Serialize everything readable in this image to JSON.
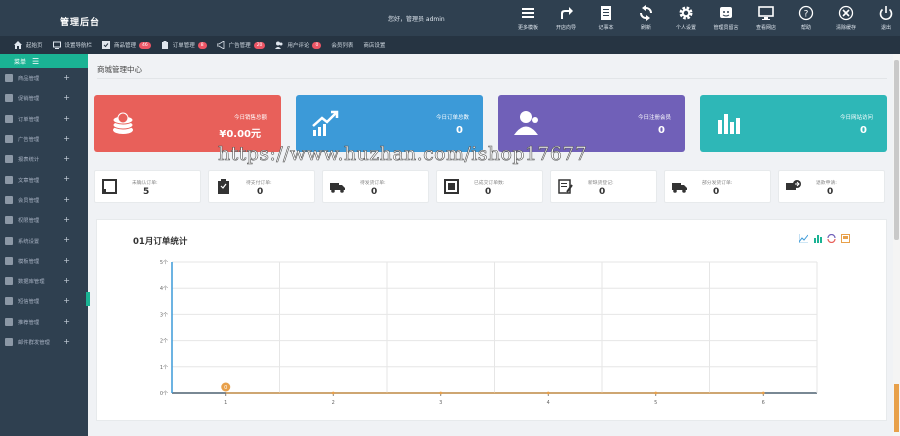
{
  "header": {
    "brand": "管理后台",
    "greeting": "您好，管理员 admin",
    "tools": [
      {
        "label": "更多模板",
        "icon": "menu-icon"
      },
      {
        "label": "开店向导",
        "icon": "share-arrow-icon"
      },
      {
        "label": "记事本",
        "icon": "notepad-icon"
      },
      {
        "label": "刷新",
        "icon": "refresh-icon"
      },
      {
        "label": "个人设置",
        "icon": "gear-icon"
      },
      {
        "label": "管理员留言",
        "icon": "message-icon"
      },
      {
        "label": "查看网店",
        "icon": "monitor-icon"
      },
      {
        "label": "帮助",
        "icon": "help-icon"
      },
      {
        "label": "清除缓存",
        "icon": "clear-cache-icon"
      },
      {
        "label": "退出",
        "icon": "power-icon"
      }
    ]
  },
  "nav": [
    {
      "label": "起始页",
      "badge": ""
    },
    {
      "label": "设置导航栏",
      "badge": ""
    },
    {
      "label": "商品管理",
      "badge": "46"
    },
    {
      "label": "订单管理",
      "badge": "8"
    },
    {
      "label": "广告管理",
      "badge": "20"
    },
    {
      "label": "用户评论",
      "badge": "0"
    },
    {
      "label": "会员列表",
      "badge": ""
    },
    {
      "label": "商店设置",
      "badge": ""
    }
  ],
  "sidebar": {
    "title": "菜单",
    "items": [
      "商品管理",
      "促销管理",
      "订单管理",
      "广告管理",
      "报表统计",
      "文章管理",
      "会员管理",
      "权限管理",
      "系统设置",
      "模板管理",
      "数据库管理",
      "短信管理",
      "推荐管理",
      "邮件群发管理"
    ]
  },
  "page_title": "商城管理中心",
  "stats": [
    {
      "label": "今日销售总额",
      "value": "¥0.00元",
      "color": "#e8605a",
      "icon": "money-coins-icon"
    },
    {
      "label": "今日订单总数",
      "value": "0",
      "color": "#3c9ad8",
      "icon": "trend-up-icon"
    },
    {
      "label": "今日注册会员",
      "value": "0",
      "color": "#7060b8",
      "icon": "users-icon"
    },
    {
      "label": "今日网站访问",
      "value": "0",
      "color": "#2eb7b7",
      "icon": "bar-chart-icon"
    }
  ],
  "cards": [
    {
      "label": "未确认订单:",
      "value": "5",
      "icon": "order-box-icon"
    },
    {
      "label": "待支付订单:",
      "value": "0",
      "icon": "payment-clipboard-icon"
    },
    {
      "label": "待发货订单:",
      "value": "0",
      "icon": "truck-icon"
    },
    {
      "label": "已成交订单数:",
      "value": "0",
      "icon": "deal-icon"
    },
    {
      "label": "新缺货登记:",
      "value": "0",
      "icon": "edit-note-icon"
    },
    {
      "label": "部分发货订单:",
      "value": "0",
      "icon": "truck-partial-icon"
    },
    {
      "label": "退款申请:",
      "value": "0",
      "icon": "refund-icon"
    }
  ],
  "watermark": "https://www.huzhan.com/ishop17677",
  "chart_data": {
    "type": "line",
    "title": "01月订单统计",
    "x": [
      "1",
      "2",
      "3",
      "4",
      "5",
      "6"
    ],
    "series": [
      {
        "values": [
          0,
          0,
          0,
          0,
          0,
          0
        ],
        "color": "#e8a04a"
      }
    ],
    "ylim": [
      0,
      5
    ],
    "yticks": [
      "0个",
      "1个",
      "2个",
      "3个",
      "4个",
      "5个"
    ],
    "highlight_label": "0",
    "grid": true
  }
}
